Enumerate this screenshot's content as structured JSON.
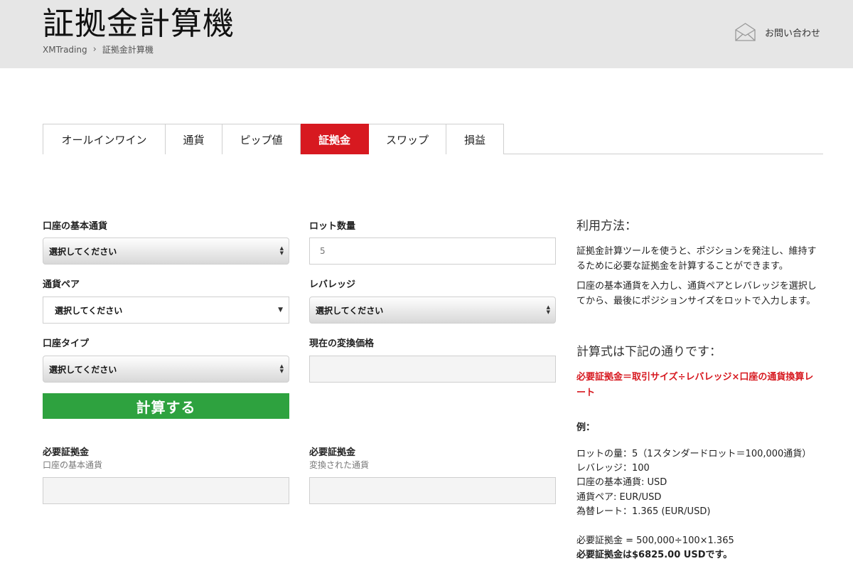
{
  "header": {
    "title": "証拠金計算機",
    "breadcrumb": {
      "home": "XMTrading",
      "separator": "›",
      "current": "証拠金計算機"
    },
    "contact_label": "お問い合わせ"
  },
  "tabs": [
    {
      "label": "オールインワイン",
      "active": false
    },
    {
      "label": "通貨",
      "active": false
    },
    {
      "label": "ピップ値",
      "active": false
    },
    {
      "label": "証拠金",
      "active": true
    },
    {
      "label": "スワップ",
      "active": false
    },
    {
      "label": "損益",
      "active": false
    }
  ],
  "form": {
    "base_currency": {
      "label": "口座の基本通貨",
      "value": "選択してください"
    },
    "currency_pair": {
      "label": "通貨ペア",
      "value": "選択してください"
    },
    "account_type": {
      "label": "口座タイプ",
      "value": "選択してください"
    },
    "lot_size": {
      "label": "ロット数量",
      "placeholder": "5"
    },
    "leverage": {
      "label": "レバレッジ",
      "value": "選択してください"
    },
    "current_rate": {
      "label": "現在の変換価格",
      "value": ""
    },
    "calculate_label": "計算する",
    "margin_base": {
      "label": "必要証拠金",
      "sub": "口座の基本通貨",
      "value": ""
    },
    "margin_converted": {
      "label": "必要証拠金",
      "sub": "変換された通貨",
      "value": ""
    }
  },
  "usage": {
    "heading": "利用方法：",
    "para1": "証拠金計算ツールを使うと、ポジションを発注し、維持するために必要な証拠金を計算することができます。",
    "para2": "口座の基本通貨を入力し、通貨ペアとレバレッジを選択してから、最後にポジションサイズをロットで入力します。",
    "formula_heading": "計算式は下記の通りです：",
    "formula": "必要証拠金＝取引サイズ÷レバレッジ×口座の通貨換算レート",
    "example_label": "例：",
    "example_lines": [
      "ロットの量：5（1スタンダードロット＝100,000通貨）",
      "レバレッジ：100",
      "口座の基本通貨: USD",
      "通貨ペア: EUR/USD",
      "為替レート：1.365 (EUR/USD)"
    ],
    "result_calc": "必要証拠金 = 500,000÷100×1.365",
    "result_bold": "必要証拠金は$6825.00 USDです。"
  },
  "colors": {
    "accent_red": "#d71920",
    "button_green": "#2ea23f",
    "header_bg": "#e6e6e6"
  },
  "icons": {
    "contact": "envelope-icon",
    "select_arrows": "updown-arrows-icon",
    "dropdown": "caret-down-icon"
  }
}
